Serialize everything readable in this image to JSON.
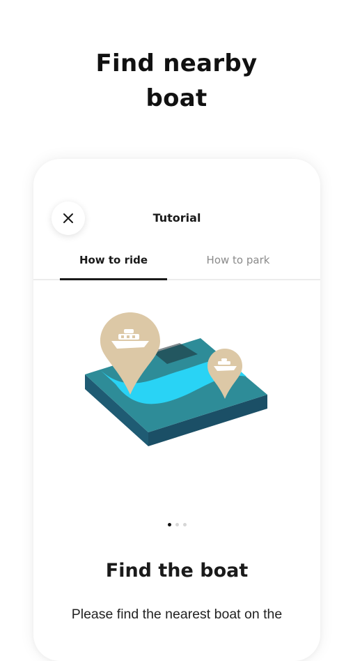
{
  "hero": {
    "title_line1": "Find nearby",
    "title_line2": "boat"
  },
  "screen": {
    "title": "Tutorial",
    "close_icon": "close-icon",
    "tabs": [
      {
        "label": "How to ride",
        "active": true
      },
      {
        "label": "How to park",
        "active": false
      }
    ],
    "illustration": "boat-on-water-map-pins",
    "pagination": {
      "current": 1,
      "total": 3
    },
    "card": {
      "title": "Find the boat",
      "text": "Please find the nearest boat on the"
    }
  },
  "colors": {
    "pin": "#DCC8A6",
    "water_light": "#29D3F5",
    "water_mid": "#2E8C98",
    "water_dark": "#1F5D78",
    "text": "#141414",
    "muted": "#8A8A8A"
  }
}
